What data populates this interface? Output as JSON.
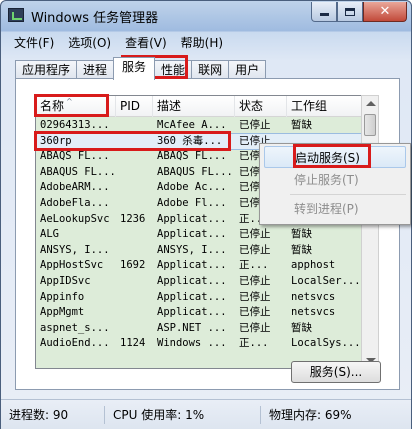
{
  "window": {
    "title": "Windows 任务管理器",
    "caption": {
      "close": "✕"
    }
  },
  "menubar": {
    "items": [
      "文件(F)",
      "选项(O)",
      "查看(V)",
      "帮助(H)"
    ]
  },
  "tabs": [
    "应用程序",
    "进程",
    "服务",
    "性能",
    "联网",
    "用户"
  ],
  "active_tab": "服务",
  "services_table": {
    "columns": [
      "名称",
      "PID",
      "描述",
      "状态",
      "工作组"
    ],
    "rows": [
      [
        "02964313...",
        "",
        "McAfee A...",
        "已停止",
        "暂缺"
      ],
      [
        "360rp",
        "",
        "360 杀毒...",
        "已停止",
        ""
      ],
      [
        "ABAQS FL...",
        "",
        "ABAQS FL...",
        "已停止",
        ""
      ],
      [
        "ABAQUS FL...",
        "",
        "ABAQUS FL...",
        "已停止",
        ""
      ],
      [
        "AdobeARM...",
        "",
        "Adobe Ac...",
        "已停止",
        ""
      ],
      [
        "AdobeFla...",
        "",
        "Adobe Fl...",
        "已停止",
        ""
      ],
      [
        "AeLookupSvc",
        "1236",
        "Applicat...",
        "正...",
        "netsvcs"
      ],
      [
        "ALG",
        "",
        "Applicat...",
        "已停止",
        "暂缺"
      ],
      [
        "ANSYS, I...",
        "",
        "ANSYS, I...",
        "已停止",
        "暂缺"
      ],
      [
        "AppHostSvc",
        "1692",
        "Applicat...",
        "正...",
        "apphost"
      ],
      [
        "AppIDSvc",
        "",
        "Applicat...",
        "已停止",
        "LocalSer..."
      ],
      [
        "Appinfo",
        "",
        "Applicat...",
        "已停止",
        "netsvcs"
      ],
      [
        "AppMgmt",
        "",
        "Applicat...",
        "已停止",
        "netsvcs"
      ],
      [
        "aspnet_s...",
        "",
        "ASP.NET ...",
        "已停止",
        "暂缺"
      ],
      [
        "AudioEnd...",
        "1124",
        "Windows ...",
        "正...",
        "LocalSys..."
      ]
    ]
  },
  "context_menu": {
    "items": [
      "启动服务(S)",
      "停止服务(T)",
      "转到进程(P)"
    ]
  },
  "services_button": {
    "label": "服务(S)..."
  },
  "status": {
    "processes": "进程数: 90",
    "cpu": "CPU 使用率: 1%",
    "memory": "物理内存: 69%"
  },
  "colors": {
    "highlight_box": "#d81b1b",
    "list_background": "#ddecd9"
  }
}
